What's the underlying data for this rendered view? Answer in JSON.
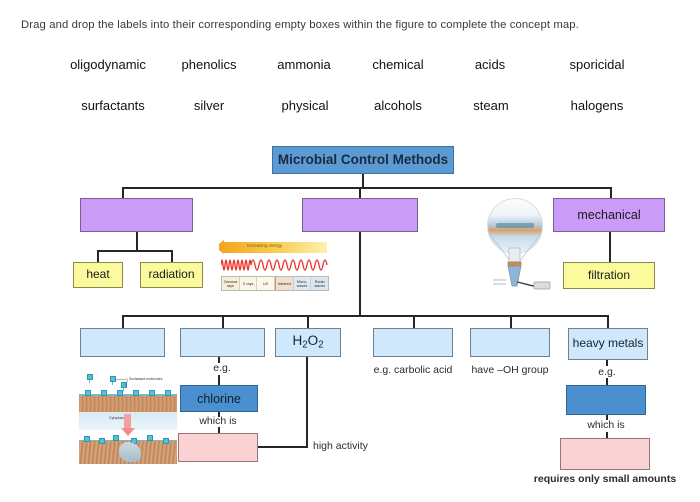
{
  "instruction": "Drag and drop the labels into their corresponding empty boxes within the figure to complete the concept map.",
  "label_bank": {
    "row1": [
      "oligodynamic",
      "phenolics",
      "ammonia",
      "chemical",
      "acids",
      "sporicidal"
    ],
    "row2": [
      "surfactants",
      "silver",
      "physical",
      "alcohols",
      "steam",
      "halogens"
    ]
  },
  "concept_map": {
    "root": {
      "label": "Microbial Control Methods",
      "color": "#5b9bd5"
    },
    "level1": [
      {
        "name": "physical-dropzone",
        "label": "",
        "empty": true,
        "color": "#cb9cf7"
      },
      {
        "name": "chemical-dropzone",
        "label": "",
        "empty": true,
        "color": "#cb9cf7"
      },
      {
        "name": "mechanical-node",
        "label": "mechanical",
        "empty": false,
        "color": "#cb9cf7"
      }
    ],
    "physical_children": [
      {
        "name": "heat-node",
        "label": "heat",
        "color": "#fbfb9e"
      },
      {
        "name": "radiation-node",
        "label": "radiation",
        "color": "#fbfb9e"
      }
    ],
    "mechanical_children": [
      {
        "name": "filtration-node",
        "label": "filtration",
        "color": "#fbfb9e"
      }
    ],
    "chemical_children": [
      {
        "name": "surfactants-dropzone",
        "label": "",
        "empty": true,
        "color": "#cfe8fb"
      },
      {
        "name": "halogens-dropzone",
        "label": "",
        "empty": true,
        "color": "#cfe8fb"
      },
      {
        "name": "peroxide-node",
        "label": "H2O2",
        "html": "H<sub>2</sub>O<sub>2</sub>",
        "empty": false,
        "color": "#cfe8fb"
      },
      {
        "name": "phenolics-dropzone",
        "label": "",
        "empty": true,
        "color": "#cfe8fb"
      },
      {
        "name": "alcohols-dropzone",
        "label": "",
        "empty": true,
        "color": "#cfe8fb"
      },
      {
        "name": "heavy-metals-node",
        "label": "heavy metals",
        "empty": false,
        "color": "#cfe8fb"
      }
    ],
    "captions": {
      "eg_halogens": "e.g.",
      "eg_heavy_metals": "e.g.",
      "carbolic_acid": "e.g. carbolic acid",
      "oh_group": "have –OH group",
      "which_is_chlorine": "which is",
      "which_is_metal": "which is",
      "high_activity": "high activity",
      "requires_small_amounts": "requires only small amounts"
    },
    "chlorine_node": {
      "name": "chlorine-node",
      "label": "chlorine",
      "color": "#4a8fcf"
    },
    "silver_dropzone": {
      "name": "silver-dropzone",
      "label": "",
      "empty": true,
      "color": "#4a8fcf"
    },
    "sporicidal_dropzone": {
      "name": "sporicidal-dropzone",
      "label": "",
      "empty": true,
      "color": "#fbd2d4"
    },
    "oligodynamic_dropzone": {
      "name": "oligodynamic-dropzone",
      "label": "",
      "empty": true,
      "color": "#fbd2d4"
    }
  },
  "figures": {
    "em_spectrum": {
      "name": "electromagnetic-spectrum-image",
      "arrow_label": "Increasing energy",
      "bands": [
        "Gamma rays",
        "X rays",
        "UV",
        "Infrared",
        "Micro- waves",
        "Radio waves"
      ]
    },
    "filtration_apparatus": {
      "name": "filtration-apparatus-image"
    },
    "surfactant_membrane": {
      "name": "surfactant-membrane-image",
      "caption_top": "Surfactant molecules",
      "caption_mid": "Cytoplasm"
    }
  }
}
